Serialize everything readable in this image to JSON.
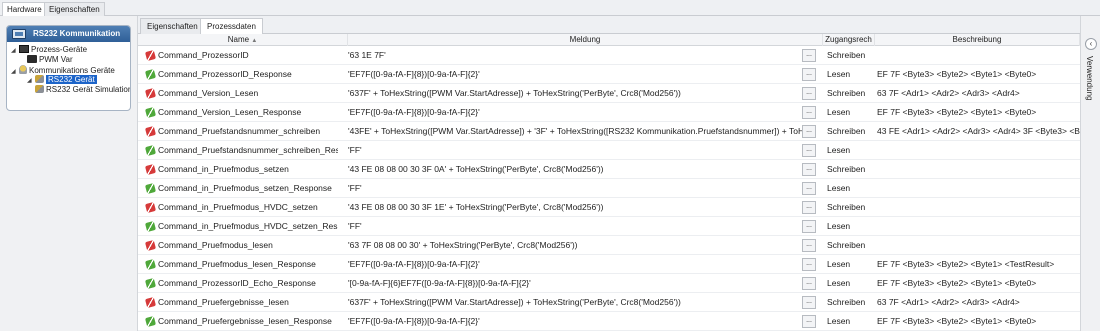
{
  "top_tabs": [
    "Hardware",
    "Eigenschaften"
  ],
  "tree": {
    "header": "RS232 Kommunikation",
    "items": [
      {
        "label": "Prozess-Geräte",
        "expanded": true
      },
      {
        "label": "PWM Var"
      },
      {
        "label": "Kommunikations Geräte",
        "expanded": true
      },
      {
        "label": "RS232 Gerät",
        "selected": true
      },
      {
        "label": "RS232 Gerät Simulation"
      }
    ]
  },
  "sub_tabs": [
    "Eigenschaften",
    "Prozessdaten"
  ],
  "columns": {
    "name": "Name",
    "message": "Meldung",
    "access": "Zugangsrech",
    "description": "Beschreibung"
  },
  "button_label": "...",
  "rows": [
    {
      "icon": "send",
      "name": "Command_ProzessorID",
      "message": "'63 1E 7F'",
      "access": "Schreiben",
      "description": ""
    },
    {
      "icon": "recv",
      "name": "Command_ProzessorID_Response",
      "message": "'EF7F([0-9a-fA-F]{8})[0-9a-fA-F]{2}'",
      "access": "Lesen",
      "description": "EF 7F <Byte3> <Byte2> <Byte1> <Byte0>"
    },
    {
      "icon": "send",
      "name": "Command_Version_Lesen",
      "message": "'637F' + ToHexString([PWM Var.StartAdresse]) + ToHexString('PerByte', Crc8('Mod256'))",
      "access": "Schreiben",
      "description": "63 7F <Adr1> <Adr2> <Adr3> <Adr4>"
    },
    {
      "icon": "recv",
      "name": "Command_Version_Lesen_Response",
      "message": "'EF7F([0-9a-fA-F]{8})[0-9a-fA-F]{2}'",
      "access": "Lesen",
      "description": "EF 7F <Byte3> <Byte2> <Byte1> <Byte0>"
    },
    {
      "icon": "send",
      "name": "Command_Pruefstandsnummer_schreiben",
      "message": "'43FE' + ToHexString([PWM Var.StartAdresse]) + '3F' + ToHexString([RS232 Kommunikation.Pruefstandsnummer]) + ToHexString('PerByte'",
      "access": "Schreiben",
      "description": "43 FE <Adr1> <Adr2> <Adr3> <Adr4> 3F <Byte3> <Byte"
    },
    {
      "icon": "recv",
      "name": "Command_Pruefstandsnummer_schreiben_Response",
      "message": "'FF'",
      "access": "Lesen",
      "description": ""
    },
    {
      "icon": "send",
      "name": "Command_in_Pruefmodus_setzen",
      "message": "'43 FE 08 08 00 30 3F 0A' + ToHexString('PerByte', Crc8('Mod256'))",
      "access": "Schreiben",
      "description": ""
    },
    {
      "icon": "recv",
      "name": "Command_in_Pruefmodus_setzen_Response",
      "message": "'FF'",
      "access": "Lesen",
      "description": ""
    },
    {
      "icon": "send",
      "name": "Command_in_Pruefmodus_HVDC_setzen",
      "message": "'43 FE 08 08 00 30 3F 1E' + ToHexString('PerByte', Crc8('Mod256'))",
      "access": "Schreiben",
      "description": ""
    },
    {
      "icon": "recv",
      "name": "Command_in_Pruefmodus_HVDC_setzen_Response",
      "message": "'FF'",
      "access": "Lesen",
      "description": ""
    },
    {
      "icon": "send",
      "name": "Command_Pruefmodus_lesen",
      "message": "'63 7F 08 08 00 30' + ToHexString('PerByte', Crc8('Mod256'))",
      "access": "Schreiben",
      "description": ""
    },
    {
      "icon": "recv",
      "name": "Command_Pruefmodus_lesen_Response",
      "message": "'EF7F([0-9a-fA-F]{8})[0-9a-fA-F]{2}'",
      "access": "Lesen",
      "description": "EF 7F <Byte3> <Byte2> <Byte1> <TestResult>"
    },
    {
      "icon": "recv",
      "name": "Command_ProzessorID_Echo_Response",
      "message": "'[0-9a-fA-F]{6}EF7F([0-9a-fA-F]{8})[0-9a-fA-F]{2}'",
      "access": "Lesen",
      "description": "EF 7F <Byte3> <Byte2> <Byte1> <Byte0>"
    },
    {
      "icon": "send",
      "name": "Command_Pruefergebnisse_lesen",
      "message": "'637F' + ToHexString([PWM Var.StartAdresse]) + ToHexString('PerByte', Crc8('Mod256'))",
      "access": "Schreiben",
      "description": "63 7F <Adr1> <Adr2> <Adr3> <Adr4>"
    },
    {
      "icon": "recv",
      "name": "Command_Pruefergebnisse_lesen_Response",
      "message": "'EF7F([0-9a-fA-F]{8})[0-9a-fA-F]{2}'",
      "access": "Lesen",
      "description": "EF 7F <Byte3> <Byte2> <Byte1> <Byte0>"
    }
  ],
  "right_panel": {
    "label": "Verwendung",
    "collapse_icon": "‹"
  }
}
